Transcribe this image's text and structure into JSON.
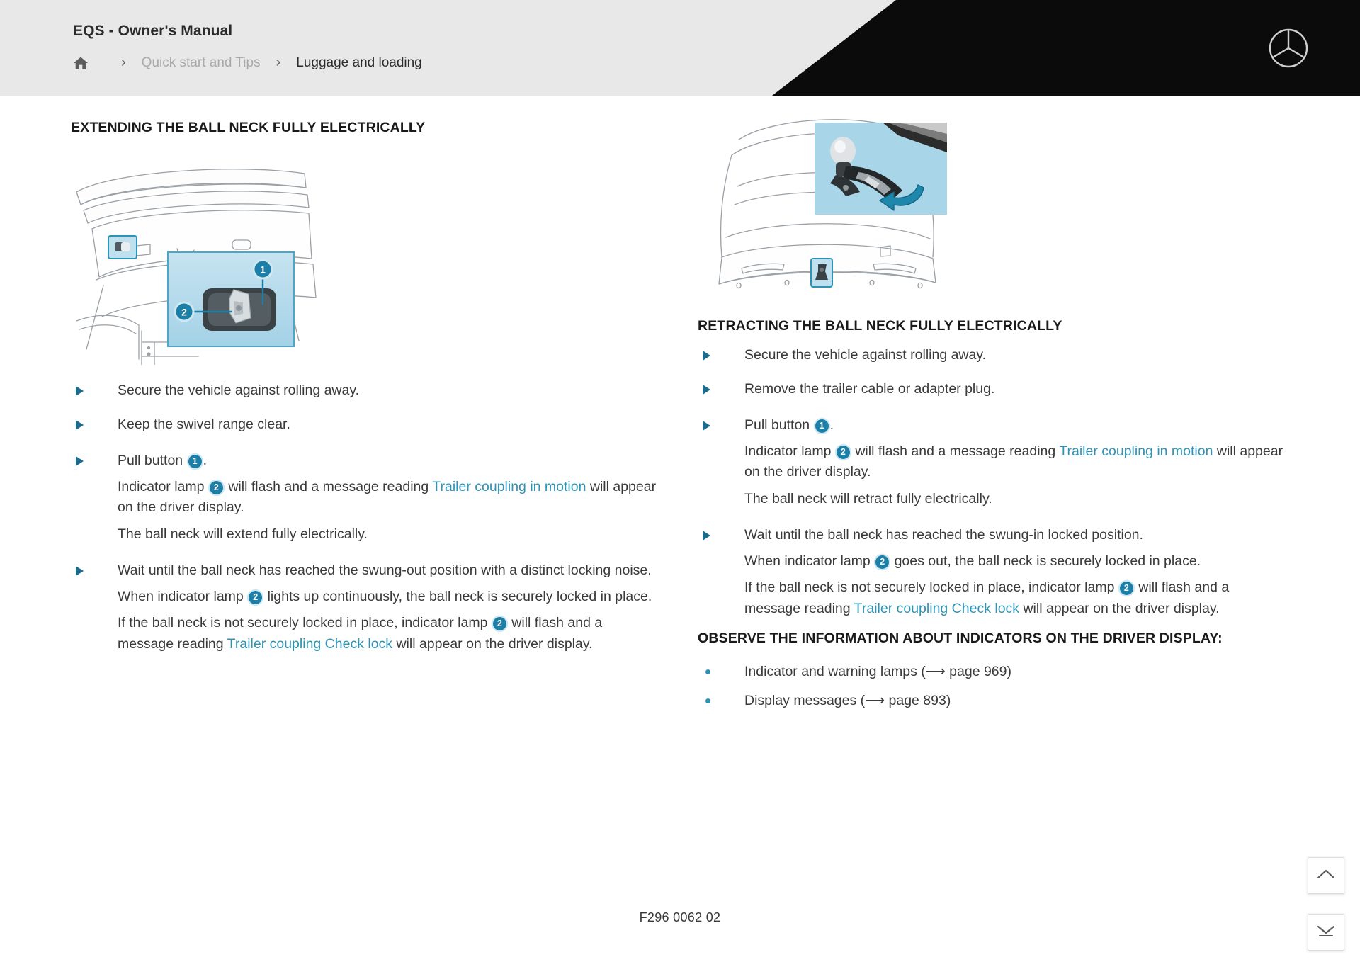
{
  "header": {
    "manual_title": "EQS - Owner's Manual",
    "breadcrumb": {
      "home_icon": "home-icon",
      "separator": "›",
      "items": [
        {
          "label": "Quick start and Tips",
          "muted": true
        },
        {
          "label": "Luggage and loading",
          "muted": false
        }
      ]
    },
    "brand_logo": "mercedes-star-icon",
    "accent_black": "#0b0b0b",
    "bar_background": "#e8e8e8"
  },
  "colors": {
    "link_teal": "#2f93b5",
    "callout_blue": "#1b7fa8",
    "bullet_triangle": "#1b6b8c",
    "inset_panel": "#a9d5e8",
    "inset_panel_light": "#bfdfee",
    "highlight_box": "#2f93b5"
  },
  "left_column": {
    "heading": "EXTENDING THE BALL NECK FULLY ELECTRICALLY",
    "figure": {
      "name": "trunk-interior-with-button-inset",
      "callouts": [
        "1",
        "2"
      ]
    },
    "steps": [
      {
        "lines": [
          {
            "text": "Secure the vehicle against rolling away."
          }
        ]
      },
      {
        "lines": [
          {
            "text": "Keep the swivel range clear."
          }
        ]
      },
      {
        "lines": [
          {
            "html": "Pull button <span class=\"num\">1</span>."
          },
          {
            "html": "Indicator lamp <span class=\"num\">2</span> will flash and a message reading <span class=\"link\">Trailer coupling in motion</span> will appear on the driver display."
          },
          {
            "html": "The ball neck will extend fully electrically."
          }
        ]
      },
      {
        "lines": [
          {
            "html": "Wait until the ball neck has reached the swung-out position with a distinct locking noise."
          },
          {
            "html": "When indicator lamp <span class=\"num\">2</span> lights up continuously, the ball neck is securely locked in place."
          },
          {
            "html": "If the ball neck is not securely locked in place, indicator lamp <span class=\"num\">2</span> will flash and a message reading <span class=\"link\">Trailer coupling Check lock</span> will appear on the driver display."
          }
        ]
      }
    ]
  },
  "right_column": {
    "figure": {
      "name": "vehicle-rear-with-ball-neck-inset",
      "arrow": "retract-arrow-icon"
    },
    "heading": "RETRACTING THE BALL NECK FULLY ELECTRICALLY",
    "steps": [
      {
        "lines": [
          {
            "text": "Secure the vehicle against rolling away."
          }
        ]
      },
      {
        "lines": [
          {
            "text": "Remove the trailer cable or adapter plug."
          }
        ]
      },
      {
        "lines": [
          {
            "html": "Pull button <span class=\"num\">1</span>."
          },
          {
            "html": "Indicator lamp <span class=\"num\">2</span> will flash and a message reading <span class=\"link\">Trailer coupling in motion</span> will appear on the driver display."
          },
          {
            "html": "The ball neck will retract fully electrically."
          }
        ]
      },
      {
        "lines": [
          {
            "html": "Wait until the ball neck has reached the swung-in locked position."
          },
          {
            "html": "When indicator lamp <span class=\"num\">2</span> goes out, the ball neck is securely locked in place."
          },
          {
            "html": "If the ball neck is not securely locked in place, indicator lamp <span class=\"num\">2</span> will flash and a message reading <span class=\"link\">Trailer coupling Check lock</span> will appear on the driver display."
          }
        ]
      }
    ],
    "subheading": "OBSERVE THE INFORMATION ABOUT INDICATORS ON THE DRIVER DISPLAY:",
    "references": [
      {
        "text": "Indicator and warning lamps (⟶ page 969)"
      },
      {
        "text": "Display messages (⟶ page 893)"
      }
    ]
  },
  "footer": {
    "figure_code": "F296 0062 02"
  },
  "floating_buttons": [
    {
      "name": "scroll-to-top-button",
      "icon": "chevron-up-icon"
    },
    {
      "name": "scroll-to-bottom-button",
      "icon": "chevron-down-end-icon"
    }
  ]
}
